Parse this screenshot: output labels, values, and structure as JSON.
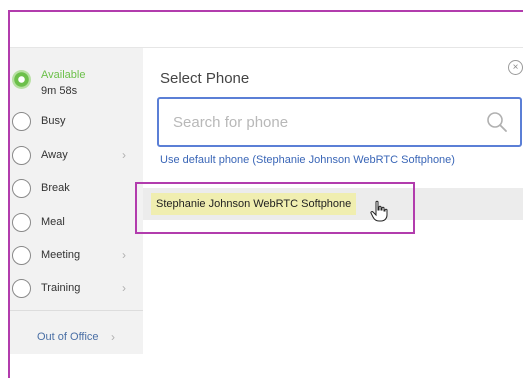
{
  "sidebar": {
    "statuses": [
      {
        "label": "Available",
        "sublabel": "9m 58s",
        "active": true
      },
      {
        "label": "Busy"
      },
      {
        "label": "Away",
        "has_submenu": true
      },
      {
        "label": "Break"
      },
      {
        "label": "Meal"
      },
      {
        "label": "Meeting",
        "has_submenu": true
      },
      {
        "label": "Training",
        "has_submenu": true
      }
    ],
    "out_of_office": "Out of Office",
    "chevron": "›"
  },
  "panel": {
    "title": "Select Phone",
    "close_glyph": "×",
    "search_placeholder": "Search for phone",
    "default_link": "Use default phone (Stephanie Johnson WebRTC Softphone)",
    "results": [
      {
        "label": "Stephanie Johnson WebRTC Softphone"
      }
    ]
  },
  "colors": {
    "available_green": "#6cc04a",
    "link_blue": "#3a66b7",
    "focus_blue": "#5b7fd6",
    "annotation_magenta": "#b23cad",
    "match_highlight": "#f0eeb0"
  }
}
